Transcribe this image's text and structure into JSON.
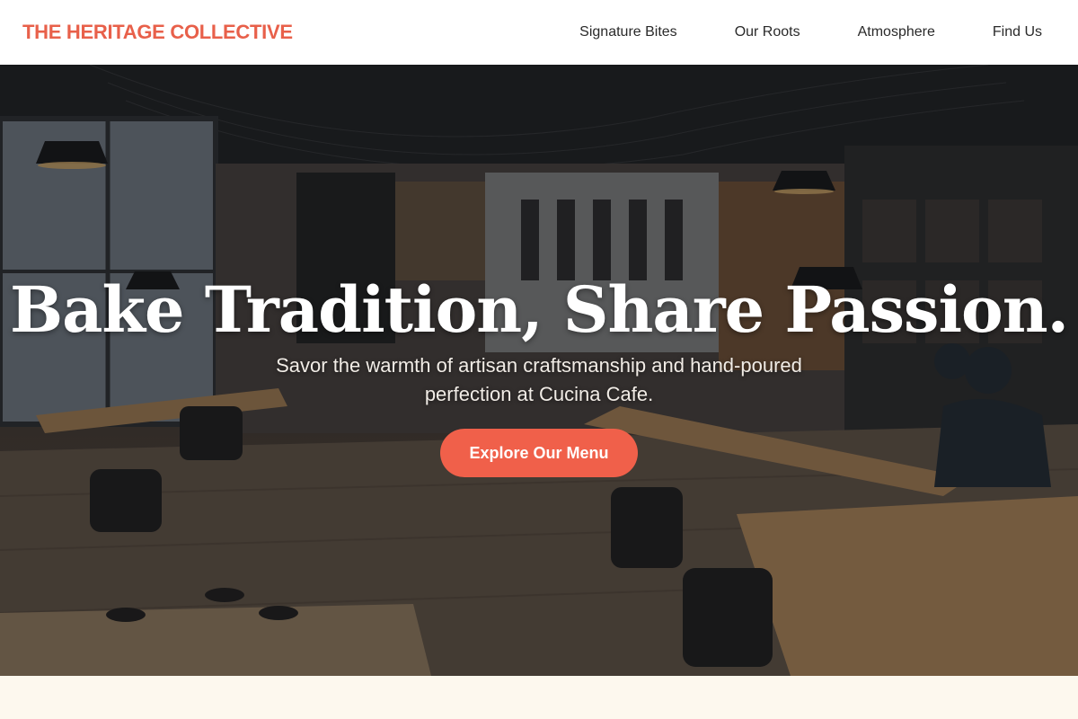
{
  "header": {
    "brand": "THE HERITAGE COLLECTIVE",
    "nav": [
      "Signature Bites",
      "Our Roots",
      "Atmosphere",
      "Find Us"
    ]
  },
  "hero": {
    "headline": "Bake Tradition, Share Passion.",
    "subhead": "Savor the warmth of artisan craftsmanship and hand-poured perfection at Cucina Cafe.",
    "cta_label": "Explore Our Menu",
    "background_image": "cafe interior with wooden tables, pendant lamps and shelves"
  },
  "colors": {
    "brand": "#e8604a",
    "cta": "#f0604a",
    "section_bg": "#fdf8ee"
  }
}
